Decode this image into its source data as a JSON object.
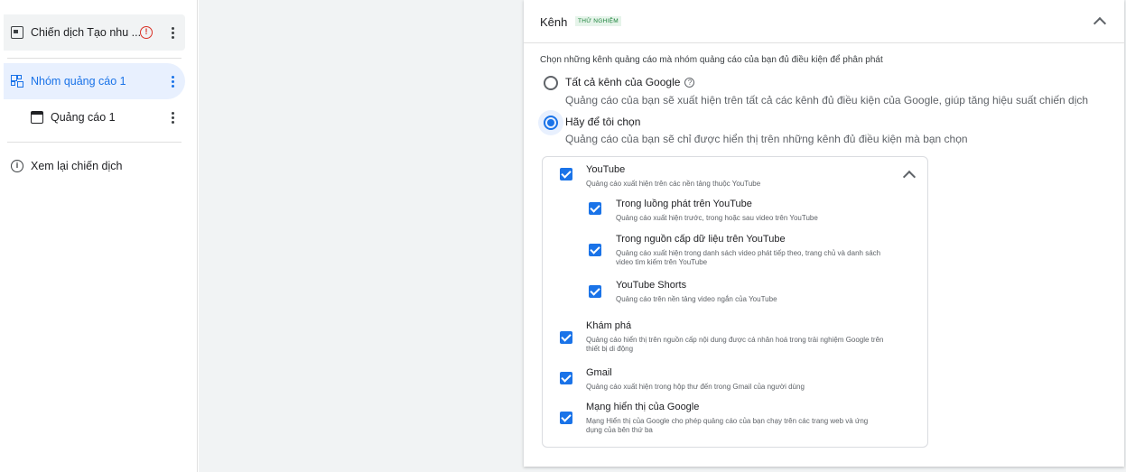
{
  "sidebar": {
    "campaign": {
      "label": "Chiến dịch Tạo nhu ...",
      "warning": "!"
    },
    "ad_group": {
      "label": "Nhóm quảng cáo 1"
    },
    "ad": {
      "label": "Quảng cáo 1"
    },
    "review": {
      "label": "Xem lại chiến dịch",
      "icon": "i"
    }
  },
  "card": {
    "title": "Kênh",
    "badge": "THỬ NGHIỆM",
    "description": "Chọn những kênh quảng cáo mà nhóm quảng cáo của bạn đủ điều kiện để phân phát",
    "options": [
      {
        "label": "Tất cả kênh của Google",
        "help": "?",
        "sub": "Quảng cáo của bạn sẽ xuất hiện trên tất cả các kênh đủ điều kiện của Google, giúp tăng hiệu suất chiến dịch",
        "selected": false
      },
      {
        "label": "Hãy để tôi chọn",
        "sub": "Quảng cáo của bạn sẽ chỉ được hiển thị trên những kênh đủ điều kiện mà bạn chọn",
        "selected": true
      }
    ],
    "channels": {
      "youtube": {
        "title": "YouTube",
        "desc": "Quảng cáo xuất hiện trên các nền tảng thuộc YouTube",
        "checked": true
      },
      "instream": {
        "title": "Trong luồng phát trên YouTube",
        "desc": "Quảng cáo xuất hiện trước, trong hoặc sau video trên YouTube",
        "checked": true
      },
      "infeed": {
        "title": "Trong nguồn cấp dữ liệu trên YouTube",
        "desc": "Quảng cáo xuất hiện trong danh sách video phát tiếp theo, trang chủ và danh sách video tìm kiếm trên YouTube",
        "checked": true
      },
      "shorts": {
        "title": "YouTube Shorts",
        "desc": "Quảng cáo trên nền tảng video ngắn của YouTube",
        "checked": true
      },
      "discover": {
        "title": "Khám phá",
        "desc": "Quảng cáo hiển thị trên nguồn cấp nội dung được cá nhân hoá trong trải nghiệm Google trên thiết bị di động",
        "checked": true
      },
      "gmail": {
        "title": "Gmail",
        "desc": "Quảng cáo xuất hiện trong hộp thư đến trong Gmail của người dùng",
        "checked": true
      },
      "display": {
        "title": "Mạng hiển thị của Google",
        "desc": "Mạng Hiển thị của Google cho phép quảng cáo của bạn chạy trên các trang web và ứng dụng của bên thứ ba",
        "checked": true
      }
    }
  },
  "colors": {
    "accent": "#1a73e8",
    "badge_bg": "#e6f4ea",
    "badge_text": "#188038",
    "warning": "#d93025"
  }
}
